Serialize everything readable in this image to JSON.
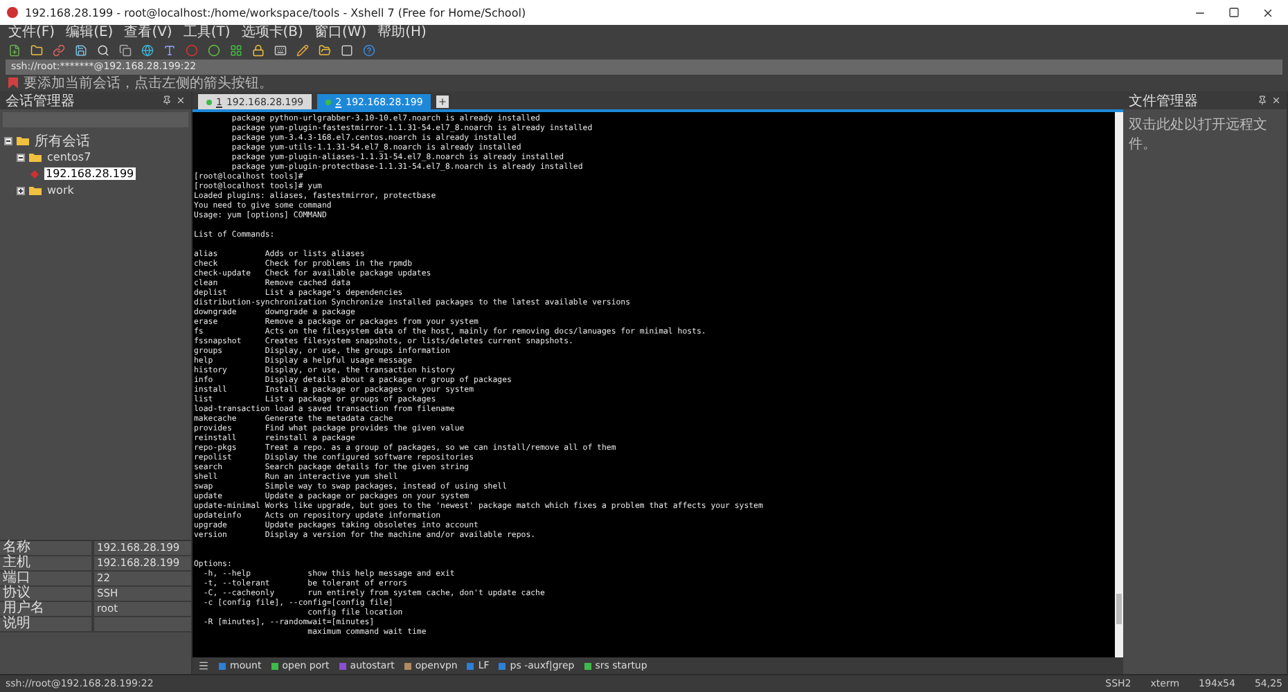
{
  "window": {
    "title": "192.168.28.199 - root@localhost:/home/workspace/tools - Xshell 7 (Free for Home/School)"
  },
  "menu": [
    "文件(F)",
    "编辑(E)",
    "查看(V)",
    "工具(T)",
    "选项卡(B)",
    "窗口(W)",
    "帮助(H)"
  ],
  "address_bar": {
    "value": "ssh://root:*******@192.168.28.199:22"
  },
  "info_bar": {
    "text": "要添加当前会话，点击左侧的箭头按钮。"
  },
  "session_manager": {
    "title": "会话管理器",
    "tree": [
      {
        "label": "所有会话",
        "kind": "folder",
        "expanded": true,
        "selected": false,
        "children": [
          {
            "label": "centos7",
            "kind": "folder",
            "expanded": true,
            "selected": false,
            "children": [
              {
                "label": "192.168.28.199",
                "kind": "session",
                "selected": true
              }
            ]
          },
          {
            "label": "work",
            "kind": "folder",
            "expanded": false,
            "selected": false
          }
        ]
      }
    ],
    "properties": [
      {
        "name": "名称",
        "value": "192.168.28.199"
      },
      {
        "name": "主机",
        "value": "192.168.28.199"
      },
      {
        "name": "端口",
        "value": "22"
      },
      {
        "name": "协议",
        "value": "SSH"
      },
      {
        "name": "用户名",
        "value": "root"
      },
      {
        "name": "说明"
      }
    ]
  },
  "tabs": [
    {
      "number": "1",
      "label": "192.168.28.199",
      "selected": false
    },
    {
      "number": "2",
      "label": "192.168.28.199",
      "selected": true
    }
  ],
  "terminal": {
    "blocks": [
      {
        "kind": "text",
        "lines": [
          "        package python-urlgrabber-3.10-10.el7.noarch is already installed",
          "        package yum-plugin-fastestmirror-1.1.31-54.el7_8.noarch is already installed",
          "        package yum-3.4.3-168.el7.centos.noarch is already installed",
          "        package yum-utils-1.1.31-54.el7_8.noarch is already installed",
          "        package yum-plugin-aliases-1.1.31-54.el7_8.noarch is already installed",
          "        package yum-plugin-protectbase-1.1.31-54.el7_8.noarch is already installed",
          "[root@localhost tools]#",
          "[root@localhost tools]# yum",
          "Loaded plugins: aliases, fastestmirror, protectbase",
          "You need to give some command",
          "Usage: yum [options] COMMAND"
        ]
      },
      {
        "kind": "blank"
      },
      {
        "kind": "text",
        "lines": [
          "List of Commands:"
        ]
      },
      {
        "kind": "blank"
      },
      {
        "kind": "text",
        "lines": [
          "alias          Adds or lists aliases",
          "check          Check for problems in the rpmdb",
          "check-update   Check for available package updates",
          "clean          Remove cached data",
          "deplist        List a package's dependencies",
          "distribution-synchronization Synchronize installed packages to the latest available versions",
          "downgrade      downgrade a package",
          "erase          Remove a package or packages from your system",
          "fs             Acts on the filesystem data of the host, mainly for removing docs/lanuages for minimal hosts.",
          "fssnapshot     Creates filesystem snapshots, or lists/deletes current snapshots.",
          "groups         Display, or use, the groups information",
          "help           Display a helpful usage message",
          "history        Display, or use, the transaction history",
          "info           Display details about a package or group of packages",
          "install        Install a package or packages on your system",
          "list           List a package or groups of packages",
          "load-transaction load a saved transaction from filename",
          "makecache      Generate the metadata cache",
          "provides       Find what package provides the given value",
          "reinstall      reinstall a package",
          "repo-pkgs      Treat a repo. as a group of packages, so we can install/remove all of them",
          "repolist       Display the configured software repositories",
          "search         Search package details for the given string",
          "shell          Run an interactive yum shell",
          "swap           Simple way to swap packages, instead of using shell",
          "update         Update a package or packages on your system",
          "update-minimal Works like upgrade, but goes to the 'newest' package match which fixes a problem that affects your system",
          "updateinfo     Acts on repository update information",
          "upgrade        Update packages taking obsoletes into account",
          "version        Display a version for the machine and/or available repos."
        ]
      },
      {
        "kind": "blank"
      },
      {
        "kind": "blank"
      },
      {
        "kind": "text",
        "lines": [
          "Options:",
          "  -h, --help            show this help message and exit",
          "  -t, --tolerant        be tolerant of errors",
          "  -C, --cacheonly       run entirely from system cache, don't update cache",
          "  -c [config file], --config=[config file]",
          "                        config file location",
          "  -R [minutes], --randomwait=[minutes]",
          "                        maximum command wait time"
        ]
      }
    ]
  },
  "quick_commands": [
    {
      "label": "mount",
      "color": "#2e7fd6"
    },
    {
      "label": "open port",
      "color": "#3dbb4a"
    },
    {
      "label": "autostart",
      "color": "#8a4fd0"
    },
    {
      "label": "openvpn",
      "color": "#b08a60"
    },
    {
      "label": "LF",
      "color": "#2e7fd6"
    },
    {
      "label": "ps -auxf|grep",
      "color": "#2e7fd6"
    },
    {
      "label": "srs startup",
      "color": "#3dbb4a"
    }
  ],
  "file_manager": {
    "title": "文件管理器",
    "hint": "双击此处以打开远程文件。"
  },
  "status_bar": {
    "connection": "ssh://root@192.168.28.199:22",
    "items": [
      "SSH2",
      "xterm",
      "194x54",
      "54,25"
    ]
  }
}
